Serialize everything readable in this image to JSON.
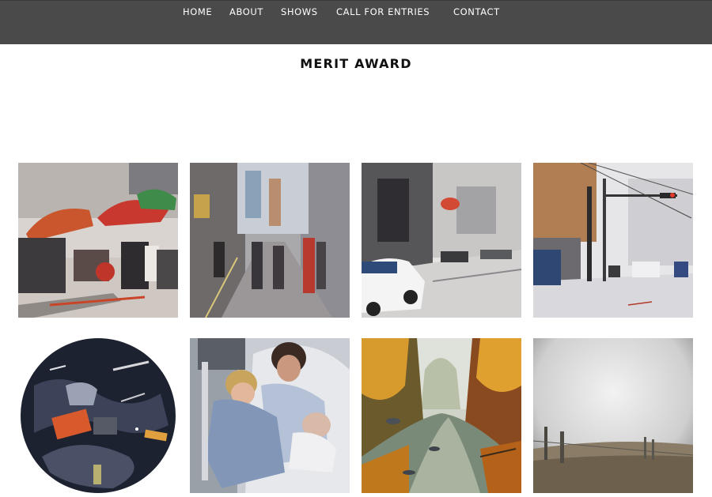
{
  "nav": {
    "items": [
      {
        "label": "HOME"
      },
      {
        "label": "ABOUT"
      },
      {
        "label": "SHOWS"
      },
      {
        "label": "CALL FOR ENTRIES"
      },
      {
        "label": "CONTACT"
      }
    ]
  },
  "page": {
    "title": "MERIT AWARD"
  },
  "gallery": {
    "artworks": [
      {
        "subject": "street market with umbrellas painting"
      },
      {
        "subject": "busy city street with scooters painting"
      },
      {
        "subject": "street with white car painting"
      },
      {
        "subject": "intersection with traffic light painting"
      },
      {
        "subject": "circular still life painting"
      },
      {
        "subject": "mother and children in hospital painting"
      },
      {
        "subject": "autumn river with birds painting"
      },
      {
        "subject": "foggy field with fence posts painting"
      }
    ]
  }
}
